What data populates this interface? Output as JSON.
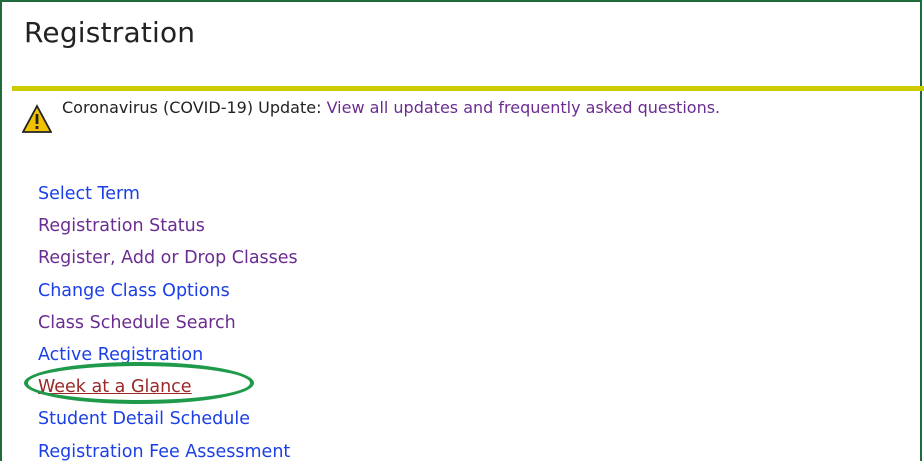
{
  "page": {
    "title": "Registration"
  },
  "notice": {
    "prefix": "Coronavirus (COVID-19) Update: ",
    "link": "View all updates and frequently asked questions."
  },
  "menu": {
    "items": [
      {
        "label": "Select Term",
        "color": "#1a3ee8"
      },
      {
        "label": "Registration Status",
        "color": "#6b2c91"
      },
      {
        "label": "Register, Add or Drop Classes",
        "color": "#6b2c91"
      },
      {
        "label": "Change Class Options",
        "color": "#1a3ee8"
      },
      {
        "label": "Class Schedule Search",
        "color": "#6b2c91"
      },
      {
        "label": "Active Registration",
        "color": "#1a3ee8"
      },
      {
        "label": "Week at a Glance",
        "color": "#9b2727",
        "highlighted": true
      },
      {
        "label": "Student Detail Schedule",
        "color": "#1a3ee8"
      },
      {
        "label": "Registration Fee Assessment",
        "color": "#1a3ee8"
      }
    ]
  },
  "colors": {
    "frame_border": "#1f6b3a",
    "rule": "#cccc00",
    "highlight_oval": "#1f9a4a",
    "warning_icon": "#f2c200"
  }
}
